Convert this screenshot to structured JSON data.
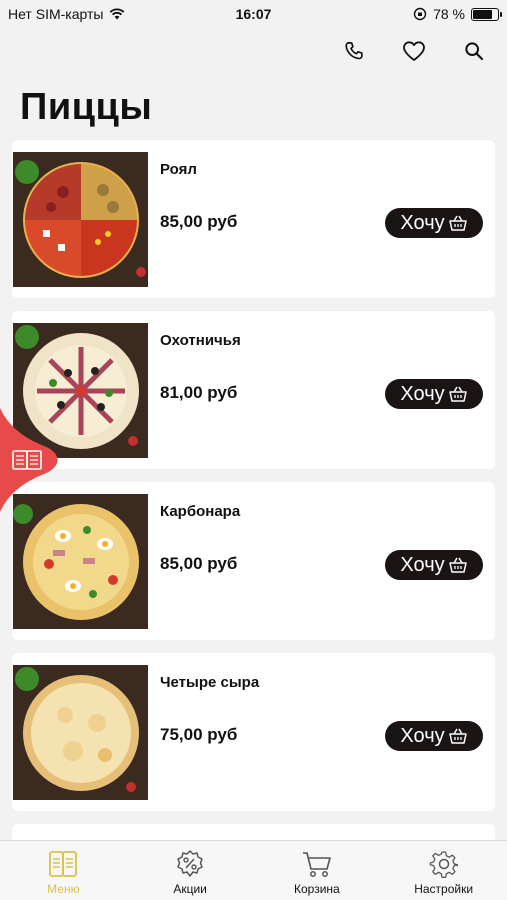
{
  "status": {
    "carrier": "Нет SIM-карты",
    "time": "16:07",
    "battery": "78 %",
    "battery_level": 0.78
  },
  "header": {
    "icons": [
      "phone-icon",
      "heart-icon",
      "search-icon"
    ]
  },
  "page_title": "Пиццы",
  "products": [
    {
      "name": "Роял",
      "price": "85,00 руб",
      "button": "Хочу"
    },
    {
      "name": "Охотничья",
      "price": "81,00 руб",
      "button": "Хочу"
    },
    {
      "name": "Карбонара",
      "price": "85,00 руб",
      "button": "Хочу"
    },
    {
      "name": "Четыре сыра",
      "price": "75,00 руб",
      "button": "Хочу"
    }
  ],
  "tabbar": [
    {
      "label": "Меню",
      "icon": "menu-book-icon",
      "active": true
    },
    {
      "label": "Акции",
      "icon": "discount-icon",
      "active": false
    },
    {
      "label": "Корзина",
      "icon": "cart-icon",
      "active": false
    },
    {
      "label": "Настройки",
      "icon": "gear-icon",
      "active": false
    }
  ],
  "colors": {
    "accent": "#d8c24a",
    "button": "#1a1414",
    "side_tab": "#e84a4a"
  }
}
